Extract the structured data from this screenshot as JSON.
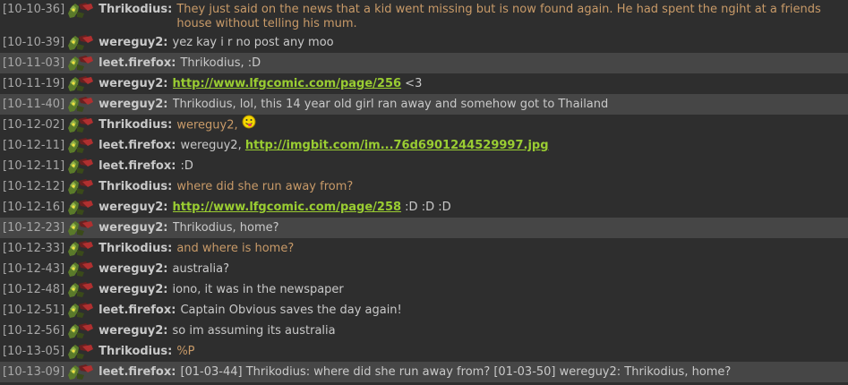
{
  "messages": [
    {
      "time": "[10-10-36]",
      "nick": "Thrikodius:",
      "type": "thr",
      "tall": true,
      "highlight": false,
      "parts": [
        {
          "t": "They just said on the news that a kid went missing but is now found again. He had spent the ngiht at a friends house without telling his mum."
        }
      ]
    },
    {
      "time": "[10-10-39]",
      "nick": "wereguy2:",
      "type": "n",
      "highlight": false,
      "parts": [
        {
          "t": "yez kay i r no post any moo"
        }
      ]
    },
    {
      "time": "[10-11-03]",
      "nick": "leet.firefox:",
      "type": "n",
      "highlight": true,
      "parts": [
        {
          "t": "Thrikodius, :D"
        }
      ]
    },
    {
      "time": "[10-11-19]",
      "nick": "wereguy2:",
      "type": "n",
      "highlight": false,
      "parts": [
        {
          "l": "http://www.lfgcomic.com/page/256"
        },
        {
          "t": " <3"
        }
      ]
    },
    {
      "time": "[10-11-40]",
      "nick": "wereguy2:",
      "type": "n",
      "highlight": true,
      "parts": [
        {
          "t": "Thrikodius, lol, this 14 year old girl ran away and somehow got to Thailand"
        }
      ]
    },
    {
      "time": "[10-12-02]",
      "nick": "Thrikodius:",
      "type": "thr",
      "highlight": false,
      "parts": [
        {
          "t": "wereguy2,"
        },
        {
          "s": "tongue-smiley-icon"
        }
      ]
    },
    {
      "time": "[10-12-11]",
      "nick": "leet.firefox:",
      "type": "n",
      "highlight": false,
      "parts": [
        {
          "t": "wereguy2, "
        },
        {
          "l": "http://imgbit.com/im...76d6901244529997.jpg"
        }
      ]
    },
    {
      "time": "[10-12-11]",
      "nick": "leet.firefox:",
      "type": "n",
      "highlight": false,
      "parts": [
        {
          "t": ":D"
        }
      ]
    },
    {
      "time": "[10-12-12]",
      "nick": "Thrikodius:",
      "type": "thr",
      "highlight": false,
      "parts": [
        {
          "t": "where did she run away from?"
        }
      ]
    },
    {
      "time": "[10-12-16]",
      "nick": "wereguy2:",
      "type": "n",
      "highlight": false,
      "parts": [
        {
          "l": "http://www.lfgcomic.com/page/258"
        },
        {
          "t": " :D :D :D"
        }
      ]
    },
    {
      "time": "[10-12-23]",
      "nick": "wereguy2:",
      "type": "n",
      "highlight": true,
      "parts": [
        {
          "t": "Thrikodius, home?"
        }
      ]
    },
    {
      "time": "[10-12-33]",
      "nick": "Thrikodius:",
      "type": "thr",
      "highlight": false,
      "parts": [
        {
          "t": "and where is home?"
        }
      ]
    },
    {
      "time": "[10-12-43]",
      "nick": "wereguy2:",
      "type": "n",
      "highlight": false,
      "parts": [
        {
          "t": "australia?"
        }
      ]
    },
    {
      "time": "[10-12-48]",
      "nick": "wereguy2:",
      "type": "n",
      "highlight": false,
      "parts": [
        {
          "t": "iono, it was in the newspaper"
        }
      ]
    },
    {
      "time": "[10-12-51]",
      "nick": "leet.firefox:",
      "type": "n",
      "highlight": false,
      "parts": [
        {
          "t": "Captain Obvious saves the day again!"
        }
      ]
    },
    {
      "time": "[10-12-56]",
      "nick": "wereguy2:",
      "type": "n",
      "highlight": false,
      "parts": [
        {
          "t": "so im assuming its australia"
        }
      ]
    },
    {
      "time": "[10-13-05]",
      "nick": "Thrikodius:",
      "type": "thr",
      "highlight": false,
      "parts": [
        {
          "t": "%P"
        }
      ]
    },
    {
      "time": "[10-13-09]",
      "nick": "leet.firefox:",
      "type": "n",
      "highlight": true,
      "parts": [
        {
          "t": "[01-03-44] Thrikodius: where did she run away from? [01-03-50] wereguy2: Thrikodius, home?"
        }
      ]
    }
  ],
  "colors": {
    "link": "#9acd32",
    "thrikodius_msg": "#c89a68",
    "highlight": "#464646",
    "background": "#2e2e2e"
  },
  "avatar_icon": "goblin-avatar-icon"
}
